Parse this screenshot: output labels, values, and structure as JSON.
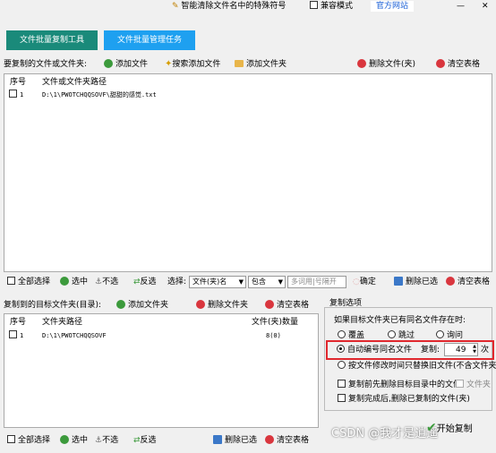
{
  "titlebar": {
    "tool_link": "智能清除文件名中的特殊符号",
    "compat_mode": "兼容模式",
    "official_site": "官方网站"
  },
  "tabs": [
    {
      "label": "文件批量复制工具"
    },
    {
      "label": "文件批量管理任务"
    }
  ],
  "source": {
    "label": "要复制的文件或文件夹:",
    "add_file": "添加文件",
    "search_add_file": "搜索添加文件",
    "add_folder": "添加文件夹",
    "delete_file": "删除文件(夹)",
    "clear_table": "清空表格",
    "col_index": "序号",
    "col_path": "文件或文件夹路径",
    "rows": [
      {
        "index": "1",
        "path": "D:\\1\\PWOTCHQQSOVF\\甜甜的感觉.txt"
      }
    ]
  },
  "source_bar": {
    "select_all": "全部选择",
    "select": "选中",
    "deselect": "不选",
    "invert": "反选",
    "choose_label": "选择:",
    "type_value": "文件(夹)名",
    "match_value": "包含",
    "keyword_placeholder": "多词用|号隔开",
    "confirm": "确定",
    "delete_selected": "删除已选",
    "clear_table": "清空表格"
  },
  "target": {
    "label": "复制到的目标文件夹(目录):",
    "add_folder": "添加文件夹",
    "delete_folder": "删除文件夹",
    "clear_table": "清空表格",
    "col_index": "序号",
    "col_path": "文件夹路径",
    "col_count": "文件(夹)数量",
    "rows": [
      {
        "index": "1",
        "path": "D:\\1\\PWOTCHQQSOVF",
        "count": "8(0)"
      }
    ]
  },
  "target_bar": {
    "select_all": "全部选择",
    "select": "选中",
    "deselect": "不选",
    "invert": "反选",
    "delete_selected": "删除已选",
    "clear_table": "清空表格"
  },
  "options": {
    "title": "复制选项",
    "same_name_label": "如果目标文件夹已有同名文件存在时:",
    "overwrite": "覆盖",
    "skip": "跳过",
    "ask": "询问",
    "auto_number": "自动编号同名文件",
    "copy_label": "复制:",
    "copy_count": "49",
    "times": "次",
    "modify_time_only": "按文件修改时间只替换旧文件(不含文件夹)",
    "delete_before": "复制前先删除目标目录中的文件",
    "folder_opt": "文件夹",
    "delete_after": "复制完成后,删除已复制的文件(夹)"
  },
  "start_button": "开始复制",
  "watermark": "CSDN @我才是逍遥",
  "colors": {
    "tab1": "#1a8a7a",
    "tab2": "#1ea0f0",
    "highlight": "#e0282e",
    "link": "#1a5fd6"
  }
}
